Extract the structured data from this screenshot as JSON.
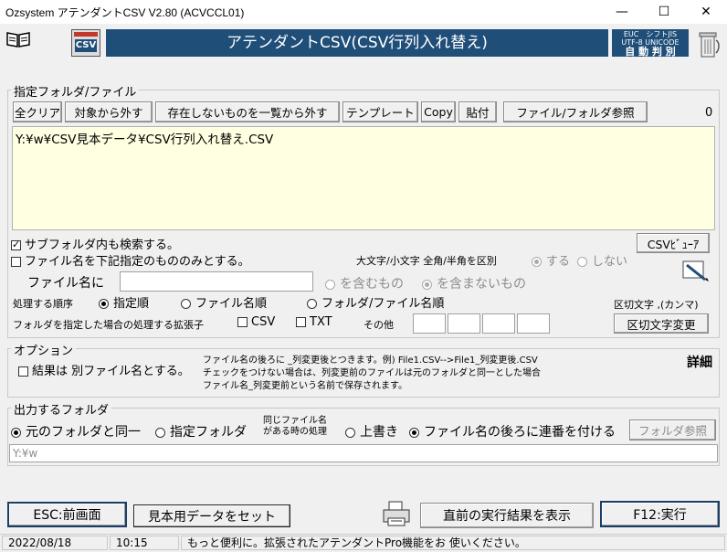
{
  "window": {
    "title": "Ozsystem アテンダントCSV V2.80 (ACVCCL01)",
    "minimize": "—",
    "maximize": "☐",
    "close": "✕"
  },
  "header": {
    "banner_title": "アテンダントCSV(CSV行列入れ替え)",
    "csv_icon_label": "CSV",
    "encoding_line1": "EUC　シフトJIS",
    "encoding_line2": "UTF-8 UNICODE",
    "encoding_line3": "自 動 判 別"
  },
  "files_group": {
    "label": "指定フォルダ/ファイル",
    "btn_clear_all": "全クリア",
    "btn_remove_target": "対象から外す",
    "btn_remove_missing": "存在しないものを一覧から外す",
    "btn_template": "テンプレート",
    "btn_copy": "Copy",
    "btn_paste": "貼付",
    "btn_browse": "ファイル/フォルダ参照",
    "count": "0",
    "file_path": "Y:¥w¥CSV見本データ¥CSV行列入れ替え.CSV",
    "search_subfolders": "サブフォルダ内も検索する。",
    "filter_by_name": "ファイル名を下記指定のもののみとする。",
    "btn_csv_viewer": "CSVﾋﾞｭｰｱ",
    "case_label": "大文字/小文字 全角/半角を区別",
    "case_yes": "する",
    "case_no": "しない",
    "filename_label": "ファイル名に",
    "contains": "を含むもの",
    "not_contains": "を含まないもの",
    "order_label": "処理する順序",
    "order_specified": "指定順",
    "order_filename": "ファイル名順",
    "order_folder_file": "フォルダ/ファイル名順",
    "delimiter_label": "区切文字 ,(カンマ)",
    "ext_label": "フォルダを指定した場合の処理する拡張子",
    "ext_csv": "CSV",
    "ext_txt": "TXT",
    "ext_other": "その他",
    "btn_delimiter_change": "区切文字変更"
  },
  "options_group": {
    "label": "オプション",
    "result_separate": "結果は 別ファイル名とする。",
    "note_line1": "ファイル名の後ろに _列変更後とつきます。例) File1.CSV-->File1_列変更後.CSV",
    "note_line2": "チェックをつけない場合は、列変更前のファイルは元のフォルダと同一とした場合",
    "note_line3": "ファイル名_列変更前という名前で保存されます。",
    "details": "詳細"
  },
  "output_group": {
    "label": "出力するフォルダ",
    "same_folder": "元のフォルダと同一",
    "specified_folder": "指定フォルダ",
    "same_name_line1": "同じファイル名",
    "same_name_line2": "がある時の処理",
    "overwrite": "上書き",
    "append_number": "ファイル名の後ろに連番を付ける",
    "btn_folder_browse": "フォルダ参照",
    "output_path": "Y:¥w"
  },
  "footer": {
    "btn_esc": "ESC:前画面",
    "btn_sample": "見本用データをセット",
    "btn_show_result": "直前の実行結果を表示",
    "btn_run": "F12:実行"
  },
  "status": {
    "date": "2022/08/18",
    "time": "10:15",
    "message": "もっと便利に。拡張されたアテンダントPro機能をお 使いください。"
  },
  "colors": {
    "banner_bg": "#1f4e79",
    "banner_fg": "#ffffff",
    "file_list_bg": "#ffffe1",
    "dark_border": "#1a3f66"
  }
}
